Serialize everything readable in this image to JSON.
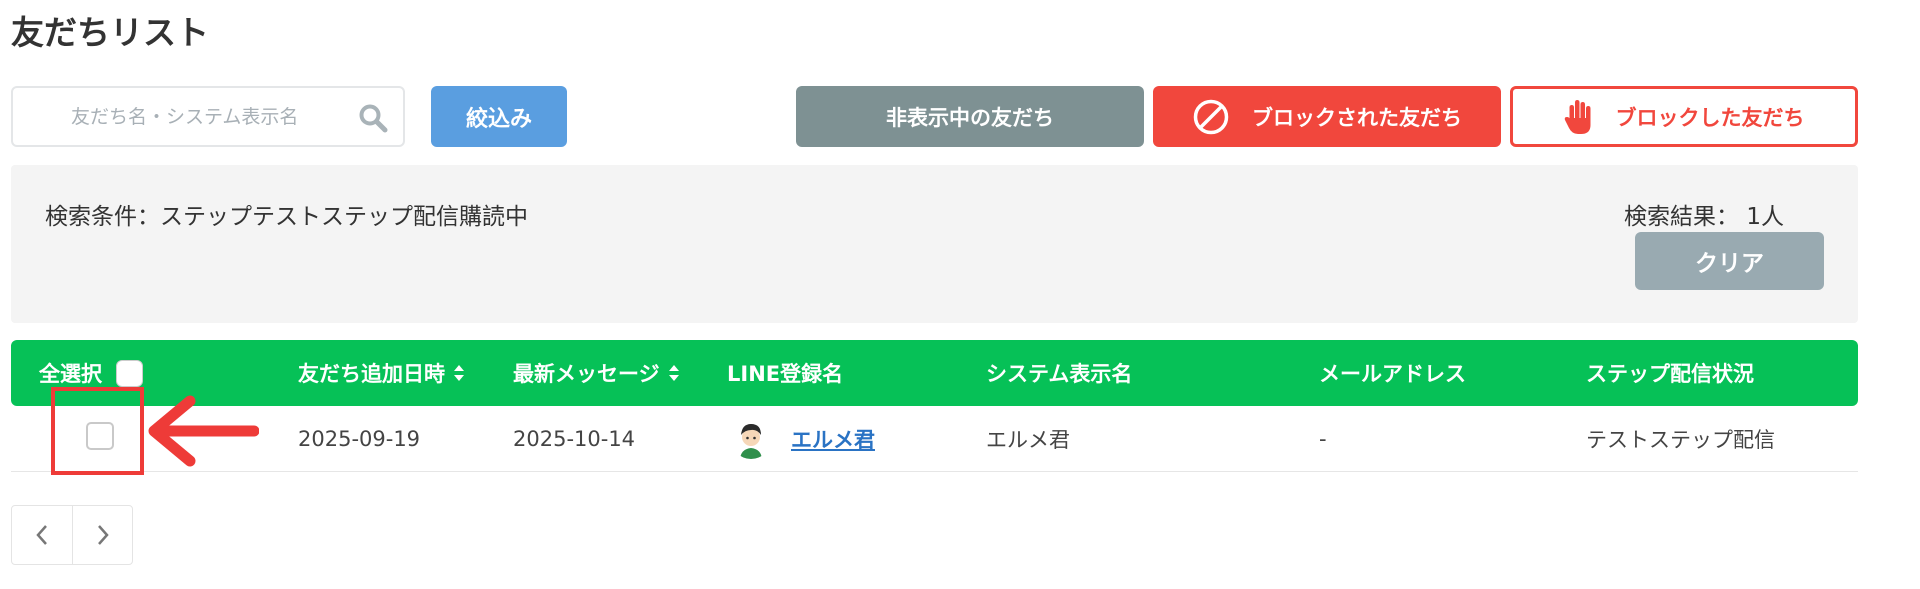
{
  "page": {
    "title": "友だちリスト"
  },
  "search": {
    "placeholder": "友だち名・システム表示名",
    "value": ""
  },
  "buttons": {
    "filter": "絞込み",
    "hidden_friends": "非表示中の友だち",
    "blocked_by_friends": "ブロックされた友だち",
    "blocked_friends": "ブロックした友だち",
    "clear": "クリア"
  },
  "conditions": {
    "text": "検索条件：ステップテストステップ配信購読中",
    "result": "検索結果： 1人"
  },
  "table": {
    "headers": {
      "select_all": "全選択",
      "added_date": "友だち追加日時",
      "latest_message": "最新メッセージ",
      "line_name": "LINE登録名",
      "system_name": "システム表示名",
      "email": "メールアドレス",
      "step_status": "ステップ配信状況"
    },
    "rows": [
      {
        "added_date": "2025-09-19",
        "latest_message": "2025-10-14",
        "line_name": "エルメ君",
        "system_name": "エルメ君",
        "email": "-",
        "step_status": "テストステップ配信"
      }
    ]
  },
  "colors": {
    "header_green": "#06c157",
    "filter_blue": "#5a9ee0",
    "block_red": "#f1473d",
    "hidden_gray": "#7e9193",
    "clear_gray": "#99aab1",
    "link_blue": "#2a73c4",
    "annotation_red": "#ee3b38"
  },
  "icons": {
    "search": "search-icon",
    "blocked_by": "prohibited-icon",
    "blocked": "hand-icon",
    "sort": "sort-icon",
    "pager_prev": "chevron-left-icon",
    "pager_next": "chevron-right-icon"
  }
}
